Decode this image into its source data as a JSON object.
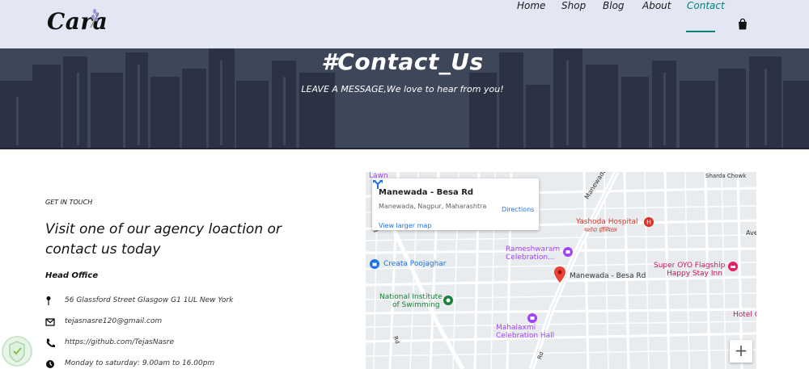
{
  "header": {
    "logo_text": "Cara",
    "nav": [
      {
        "label": "Home",
        "active": false
      },
      {
        "label": "Shop",
        "active": false
      },
      {
        "label": "Blog",
        "active": false
      },
      {
        "label": "About",
        "active": false
      },
      {
        "label": "Contact",
        "active": true
      }
    ],
    "cart_icon": "shopping-bag-icon",
    "accent_color": "#088178"
  },
  "hero": {
    "title": "#Contact_Us",
    "subtitle": "LEAVE A MESSAGE,We love to hear from you!"
  },
  "contact": {
    "kicker": "GET IN TOUCH",
    "heading": "Visit one of our agency loaction or contact us today",
    "office_title": "Head Office",
    "details": [
      {
        "icon": "map-pin-icon",
        "text": "56 Glassford Street Glasgow G1 1UL New York"
      },
      {
        "icon": "envelope-icon",
        "text": "tejasnasre120@gmail.com"
      },
      {
        "icon": "phone-icon",
        "text": "https://github.com/TejasNasre"
      },
      {
        "icon": "clock-icon",
        "text": "Monday to saturday: 9.00am to 16.00pm"
      }
    ]
  },
  "map": {
    "card": {
      "title": "Manewada - Besa Rd",
      "address": "Manewada, Nagpur, Maharashtra",
      "directions_label": "Directions",
      "larger_map_label": "View larger map"
    },
    "labels": {
      "lawn": "Lawn",
      "sharda": "Sharda Chowk",
      "manewada_road": "Manewada",
      "yashoda": "Yashoda Hospital",
      "yashoda_local": "यशोदा हॉस्पिटल",
      "rameshwaram_1": "Rameshwaram",
      "rameshwaram_2": "Celebration...",
      "creata": "Creata Poojaghar",
      "pin_label": "Manewada - Besa Rd",
      "super_oyo_1": "Super OYO Flagship",
      "super_oyo_2": "Happy Stay Inn",
      "nis_1": "National Institute",
      "nis_2": "of Swimming",
      "mahalaxmi_1": "Mahalaxmi",
      "mahalaxmi_2": "Celebration Hall",
      "hotel": "Hotel C",
      "ave": "Ave",
      "road_a": "Rd",
      "road_b": "Rd",
      "road_c": "Rd"
    },
    "zoom_in": "+"
  }
}
